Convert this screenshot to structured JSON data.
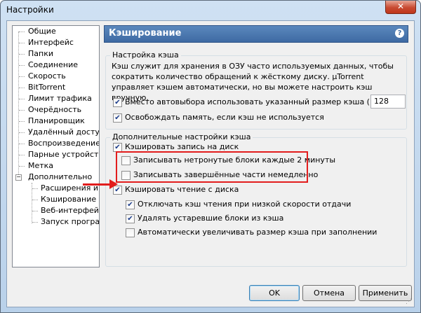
{
  "window": {
    "title": "Настройки",
    "close_glyph": "✕"
  },
  "tree": {
    "items": [
      {
        "label": "Общие"
      },
      {
        "label": "Интерфейс"
      },
      {
        "label": "Папки"
      },
      {
        "label": "Соединение"
      },
      {
        "label": "Скорость"
      },
      {
        "label": "BitTorrent"
      },
      {
        "label": "Лимит трафика"
      },
      {
        "label": "Очерёдность"
      },
      {
        "label": "Планировщик"
      },
      {
        "label": "Удалённый доступ"
      },
      {
        "label": "Воспроизведение"
      },
      {
        "label": "Парные устройства"
      },
      {
        "label": "Метка"
      },
      {
        "label": "Дополнительно"
      }
    ],
    "sub_items": [
      {
        "label": "Расширения интерфейса"
      },
      {
        "label": "Кэширование"
      },
      {
        "label": "Веб-интерфейс"
      },
      {
        "label": "Запуск программы"
      }
    ],
    "expander_glyph": "−"
  },
  "panel": {
    "header": "Кэширование",
    "help_glyph": "?",
    "group1": {
      "title": "Настройка кэша",
      "description": "Кэш служит для хранения в ОЗУ часто используемых данных, чтобы сократить количество обращений к жёсткому диску. µTorrent управляет кэшем автоматически, но вы можете настроить кэш вручную.",
      "options": [
        {
          "label": "Вместо автовыбора использовать указанный размер кэша (МБ):",
          "checked": true
        },
        {
          "label": "Освобождать память, если кэш не используется",
          "checked": true
        }
      ],
      "size_value": "128"
    },
    "group2": {
      "title": "Дополнительные настройки кэша",
      "write_cache": {
        "label": "Кэшировать запись на диск",
        "checked": true
      },
      "write_sub": [
        {
          "label": "Записывать нетронутые блоки каждые 2 минуты",
          "checked": false
        },
        {
          "label": "Записывать завершённые части немедленно",
          "checked": false
        }
      ],
      "read_cache": {
        "label": "Кэшировать чтение с диска",
        "checked": true
      },
      "read_sub": [
        {
          "label": "Отключать кэш чтения при низкой скорости отдачи",
          "checked": true
        },
        {
          "label": "Удалять устаревшие блоки из кэша",
          "checked": true
        },
        {
          "label": "Автоматически увеличивать размер кэша при заполнении",
          "checked": false
        }
      ]
    },
    "check_glyph": "✔"
  },
  "buttons": {
    "ok": "OK",
    "cancel": "Отмена",
    "apply": "Применить"
  },
  "colors": {
    "highlight": "#e21d1d",
    "header": "#3e6aa3"
  }
}
